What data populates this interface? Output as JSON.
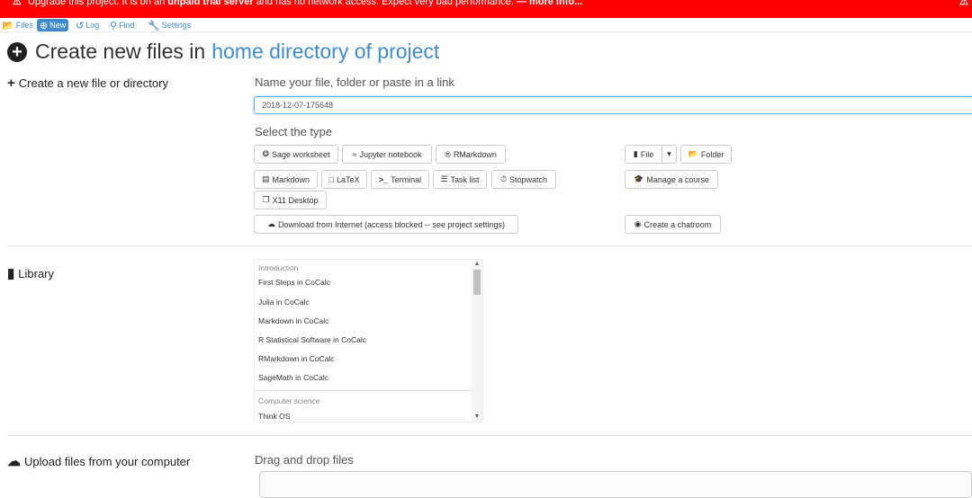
{
  "banner": {
    "text_start": "Upgrade this project. It is on an",
    "text_bold": "unpaid trial server",
    "text_end": "and has no network access. Expect very bad performance.",
    "more_info": "— more info..."
  },
  "nav": {
    "files": "Files",
    "new": "New",
    "log": "Log",
    "find": "Find",
    "settings": "Settings"
  },
  "header": {
    "title": "Create new files in",
    "title_link": "home directory of project"
  },
  "create": {
    "section_title": "Create a new file or directory",
    "name_label": "Name your file, folder or paste in a link",
    "name_value": "2018-12-07-175648",
    "type_label": "Select the type",
    "buttons": {
      "sage": "Sage worksheet",
      "jupyter": "Jupyter notebook",
      "rmarkdown": "RMarkdown",
      "file": "File",
      "folder": "Folder",
      "markdown": "Markdown",
      "latex": "LaTeX",
      "terminal": "Terminal",
      "tasklist": "Task list",
      "stopwatch": "Stopwatch",
      "course": "Manage a course",
      "x11": "X11 Desktop",
      "download": "Download from Internet (access blocked -- see project settings)",
      "chatroom": "Create a chatroom"
    }
  },
  "library": {
    "section_title": "Library",
    "categories": {
      "intro": "Introduction",
      "cs": "Computer science"
    },
    "items": [
      "First Steps in CoCalc",
      "Julia in CoCalc",
      "Markdown in CoCalc",
      "R Statistical Software in CoCalc",
      "RMarkdown in CoCalc",
      "SageMath in CoCalc",
      "Think OS"
    ]
  },
  "upload": {
    "section_title": "Upload files from your computer",
    "drop_label": "Drag and drop files"
  }
}
